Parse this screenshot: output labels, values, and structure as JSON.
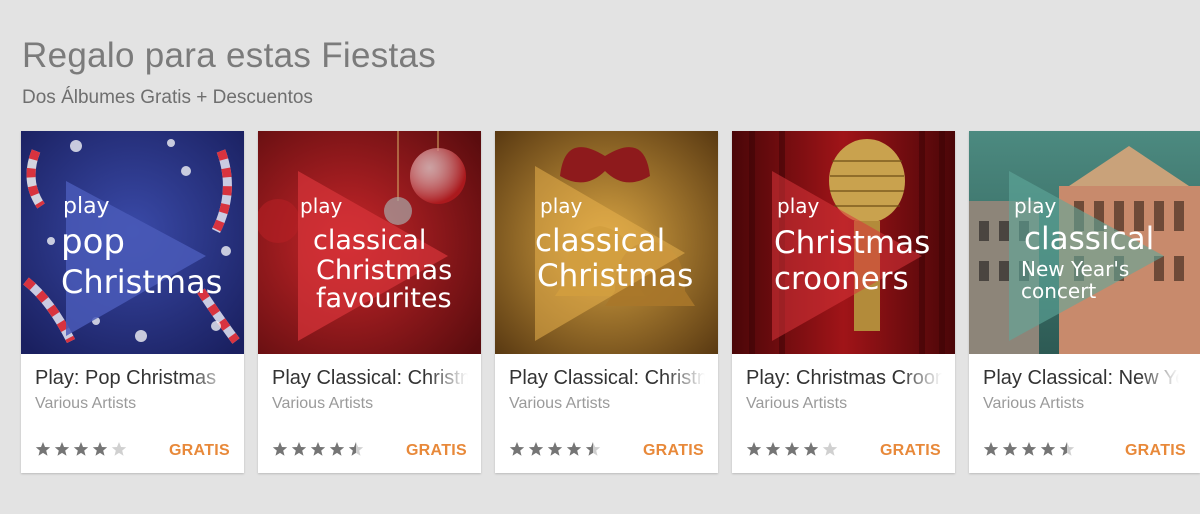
{
  "section": {
    "title": "Regalo para estas Fiestas",
    "subtitle": "Dos Álbumes Gratis + Descuentos"
  },
  "colors": {
    "background": "#e3e3e3",
    "price": "#e8893a",
    "star_filled": "#757575",
    "star_empty": "#d0d0d0"
  },
  "cards": [
    {
      "title": "Play: Pop Christmas",
      "artist": "Various Artists",
      "price": "GRATIS",
      "rating": 4,
      "cover": {
        "line1": "play",
        "line2": "pop",
        "line3": "Christmas",
        "line4": ""
      }
    },
    {
      "title": "Play Classical: Christmas Favourites",
      "artist": "Various Artists",
      "price": "GRATIS",
      "rating": 4.5,
      "cover": {
        "line1": "play",
        "line2": "classical",
        "line3": "Christmas",
        "line4": "favourites"
      }
    },
    {
      "title": "Play Classical: Christmas",
      "artist": "Various Artists",
      "price": "GRATIS",
      "rating": 4.5,
      "cover": {
        "line1": "play",
        "line2": "classical",
        "line3": "Christmas",
        "line4": ""
      }
    },
    {
      "title": "Play: Christmas Crooners",
      "artist": "Various Artists",
      "price": "GRATIS",
      "rating": 4,
      "cover": {
        "line1": "play",
        "line2": "Christmas",
        "line3": "crooners",
        "line4": ""
      }
    },
    {
      "title": "Play Classical: New Year's Concert",
      "artist": "Various Artists",
      "price": "GRATIS",
      "rating": 4.5,
      "cover": {
        "line1": "play",
        "line2": "classical",
        "line3": "New Year's",
        "line4": "concert"
      }
    }
  ]
}
